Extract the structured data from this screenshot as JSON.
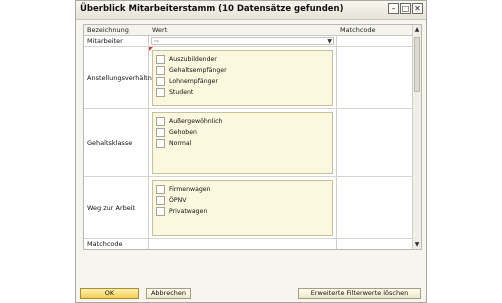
{
  "window": {
    "title": "Überblick Mitarbeiterstamm (10 Datensätze gefunden)"
  },
  "columns": {
    "c1": "Bezeichnung",
    "c2": "Wert",
    "c3": "Matchcode"
  },
  "rows": [
    {
      "label": "Mitarbeiter",
      "input_arrow": "⇨"
    },
    {
      "label": "Anstellungsverhältni",
      "options": [
        "Auszubildender",
        "Gehaltsempfänger",
        "Lohnempfänger",
        "Student"
      ]
    },
    {
      "label": "Gehaltsklasse",
      "options": [
        "Außergewöhnlich",
        "Gehoben",
        "Normal"
      ]
    },
    {
      "label": "Weg zur Arbeit",
      "options": [
        "Firmenwagen",
        "ÖPNV",
        "Privatwagen"
      ]
    },
    {
      "label": "Matchcode"
    }
  ],
  "buttons": {
    "ok": "OK",
    "cancel": "Abbrechen",
    "extended": "Erweiterte Filterwerte löschen"
  }
}
